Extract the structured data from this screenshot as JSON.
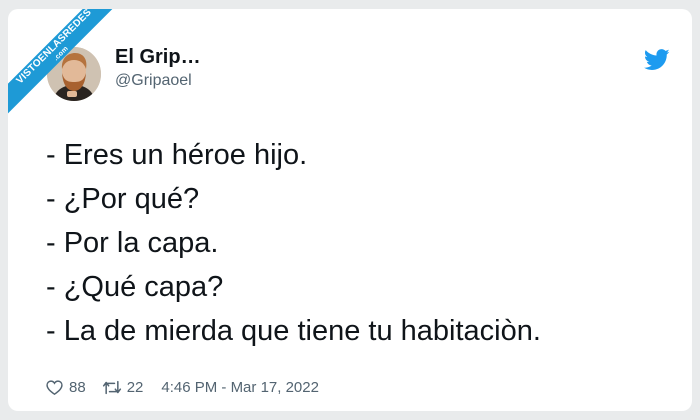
{
  "watermark": {
    "brand": "VISTOENLASREDES",
    "sub": ".com"
  },
  "author": {
    "name": "El Grip…",
    "handle": "@Gripaoel"
  },
  "tweet": {
    "lines": [
      "- Eres un héroe hijo.",
      "- ¿Por qué?",
      "- Por la capa.",
      "- ¿Qué capa?",
      "- La de mierda que tiene tu habitaciòn."
    ]
  },
  "footer": {
    "likes": "88",
    "retweets": "22",
    "timestamp": "4:46 PM - Mar 17, 2022"
  },
  "colors": {
    "twitter_blue": "#1d9bf0",
    "ribbon_blue": "#1e9ad6",
    "text": "#0f1419",
    "muted": "#536471"
  },
  "icons": {
    "like": "heart-icon",
    "retweet": "retweet-icon",
    "brand": "twitter-bird-icon"
  }
}
